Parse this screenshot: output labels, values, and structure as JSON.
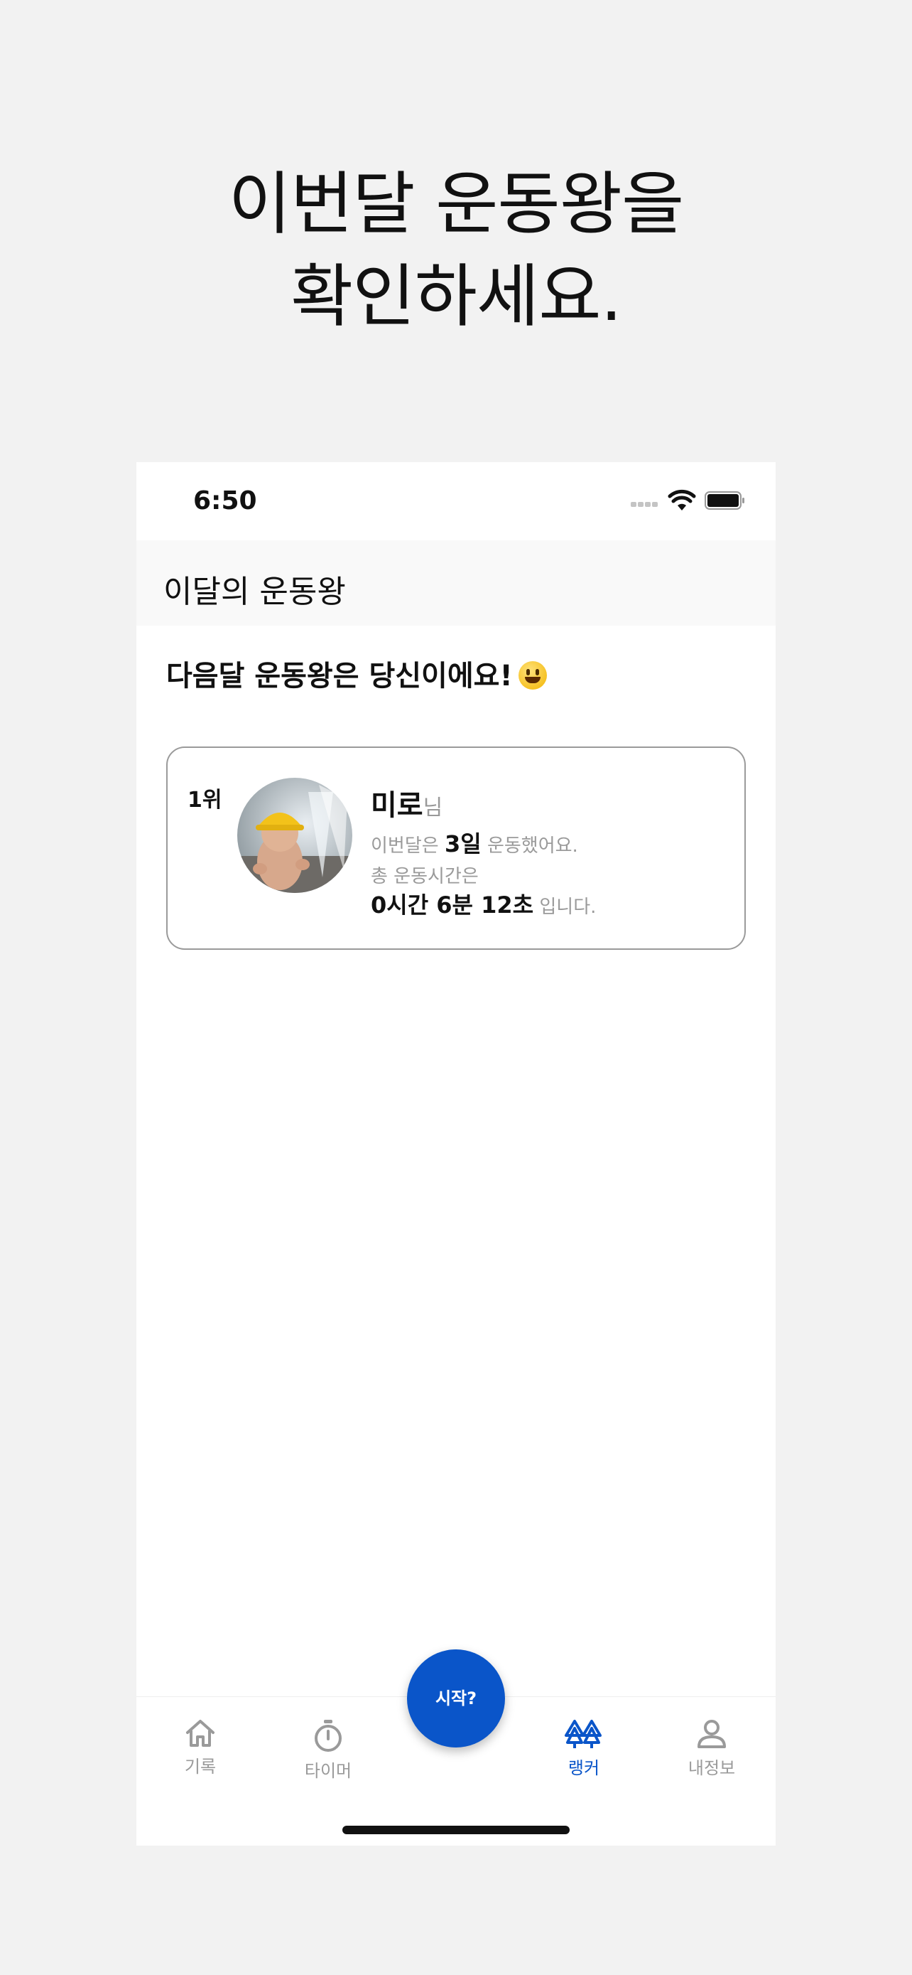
{
  "headline": {
    "line1": "이번달 운동왕을",
    "line2": "확인하세요."
  },
  "status_bar": {
    "time": "6:50"
  },
  "nav": {
    "title": "이달의 운동왕"
  },
  "subtitle": "다음달 운동왕은 당신이에요!",
  "ranking": [
    {
      "rank": "1위",
      "name": "미로",
      "honorific": "님",
      "days_prefix": "이번달은",
      "days_value": "3일",
      "days_suffix": "운동했어요.",
      "time_prefix": "총 운동시간은",
      "time_value": "0시간 6분 12초",
      "time_suffix": "입니다."
    }
  ],
  "fab": {
    "label": "시작?"
  },
  "tabs": [
    {
      "label": "기록",
      "icon": "home-icon",
      "active": false
    },
    {
      "label": "타이머",
      "icon": "stopwatch-icon",
      "active": false
    },
    {
      "label": "랭커",
      "icon": "trees-icon",
      "active": true
    },
    {
      "label": "내정보",
      "icon": "person-icon",
      "active": false
    }
  ],
  "colors": {
    "accent": "#0a55c9",
    "background": "#f2f2f2",
    "muted": "#9a9a9a"
  }
}
